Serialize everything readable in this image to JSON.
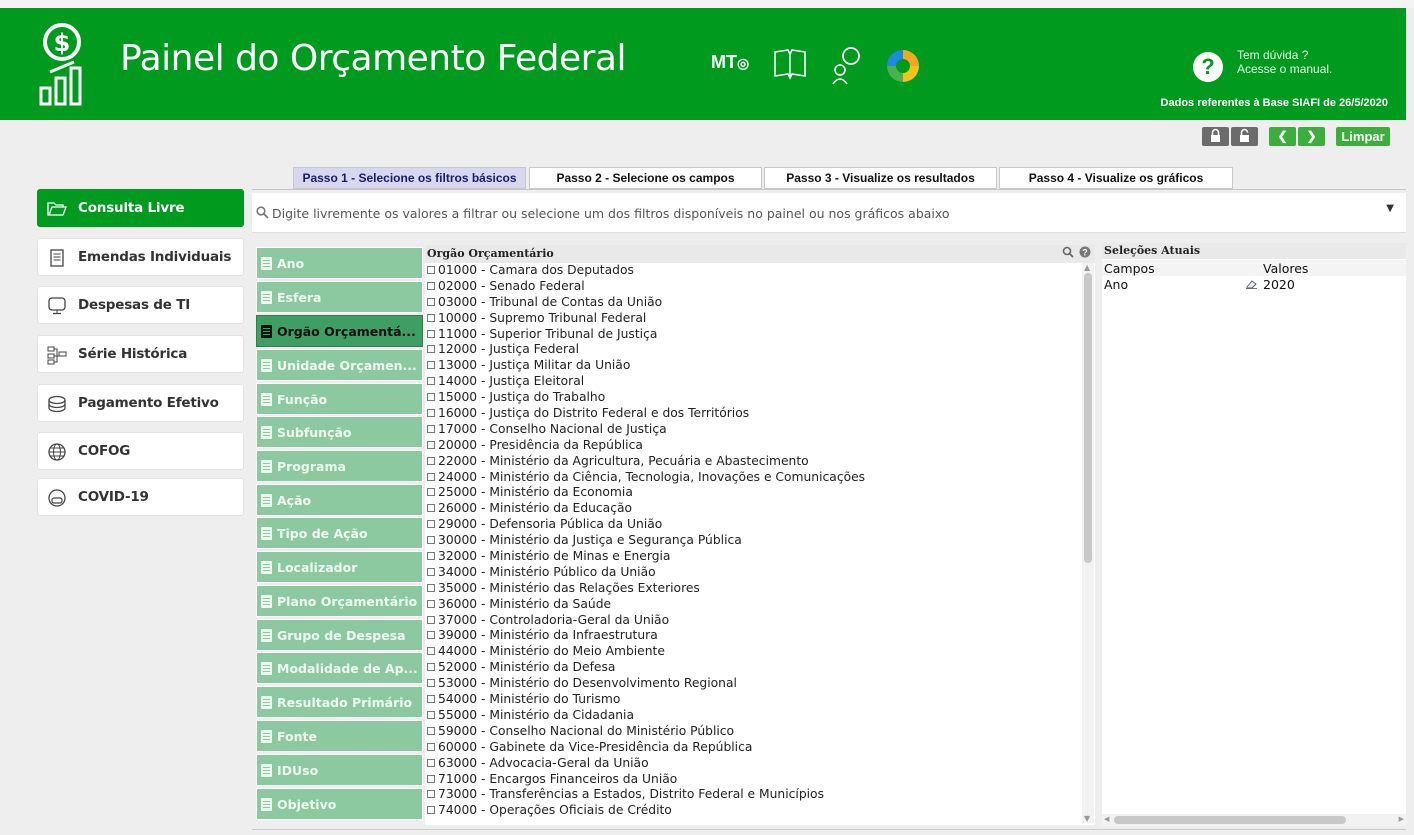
{
  "header": {
    "title": "Painel do Orçamento Federal",
    "mt_logo": "MT",
    "help_line1": "Tem dúvida ?",
    "help_line2": "Acesse o manual.",
    "base_date": "Dados referentes à Base SIAFI de 26/5/2020",
    "brand_color": "#009a1e"
  },
  "toolbar": {
    "limpar_label": "Limpar"
  },
  "tabs": [
    {
      "label": "Passo 1 - Selecione os filtros básicos",
      "active": true
    },
    {
      "label": "Passo 2 - Selecione os campos"
    },
    {
      "label": "Passo 3 - Visualize os resultados"
    },
    {
      "label": "Passo 4 - Visualize os gráficos"
    }
  ],
  "search": {
    "placeholder": "Digite livremente os valores a filtrar ou selecione um dos filtros disponíveis no painel ou nos gráficos abaixo"
  },
  "sidebar": {
    "items": [
      {
        "label": "Consulta Livre",
        "icon": "folder-open-icon",
        "active": true
      },
      {
        "label": "Emendas Individuais",
        "icon": "document-icon"
      },
      {
        "label": "Despesas de TI",
        "icon": "monitor-icon"
      },
      {
        "label": "Série Histórica",
        "icon": "hierarchy-icon"
      },
      {
        "label": "Pagamento Efetivo",
        "icon": "coins-icon"
      },
      {
        "label": "COFOG",
        "icon": "globe-icon"
      },
      {
        "label": "COVID-19",
        "icon": "mask-icon"
      }
    ]
  },
  "filters": [
    {
      "label": "Ano"
    },
    {
      "label": "Esfera"
    },
    {
      "label": "Orgão Orçamentá...",
      "active": true
    },
    {
      "label": "Unidade Orçamen..."
    },
    {
      "label": "Função"
    },
    {
      "label": "Subfunção"
    },
    {
      "label": "Programa"
    },
    {
      "label": "Ação"
    },
    {
      "label": "Tipo de Ação"
    },
    {
      "label": "Localizador"
    },
    {
      "label": "Plano Orçamentário"
    },
    {
      "label": "Grupo de Despesa"
    },
    {
      "label": "Modalidade de Ap..."
    },
    {
      "label": "Resultado Primário"
    },
    {
      "label": "Fonte"
    },
    {
      "label": "IDUso"
    },
    {
      "label": "Objetivo"
    }
  ],
  "list": {
    "title": "Orgão Orçamentário",
    "items": [
      "01000 - Camara dos Deputados",
      "02000 - Senado Federal",
      "03000 - Tribunal de Contas da União",
      "10000 - Supremo Tribunal Federal",
      "11000 - Superior Tribunal de Justiça",
      "12000 - Justiça Federal",
      "13000 - Justiça Militar da União",
      "14000 - Justiça Eleitoral",
      "15000 - Justiça do Trabalho",
      "16000 - Justiça do Distrito Federal e dos Territórios",
      "17000 - Conselho Nacional de Justiça",
      "20000 - Presidência da República",
      "22000 - Ministério da Agricultura, Pecuária e Abastecimento",
      "24000 - Ministério da Ciência, Tecnologia, Inovações e Comunicações",
      "25000 - Ministério da Economia",
      "26000 - Ministério da Educação",
      "29000 - Defensoria Pública da União",
      "30000 - Ministério da Justiça e Segurança Pública",
      "32000 - Ministério de Minas e Energia",
      "34000 - Ministério Público da União",
      "35000 - Ministério das Relações Exteriores",
      "36000 - Ministério da Saúde",
      "37000 - Controladoria-Geral da União",
      "39000 - Ministério da Infraestrutura",
      "44000 - Ministério do Meio Ambiente",
      "52000 - Ministério da Defesa",
      "53000 - Ministério do Desenvolvimento Regional",
      "54000 - Ministério do Turismo",
      "55000 - Ministério da Cidadania",
      "59000 - Conselho Nacional do Ministério Público",
      "60000 - Gabinete da Vice-Presidência da República",
      "63000 - Advocacia-Geral da União",
      "71000 - Encargos Financeiros da União",
      "73000 - Transferências a Estados, Distrito Federal e Municípios",
      "74000 - Operações Oficiais de Crédito"
    ]
  },
  "selections": {
    "title": "Seleções Atuais",
    "col_campos": "Campos",
    "col_valores": "Valores",
    "rows": [
      {
        "campo": "Ano",
        "valor": "2020"
      }
    ]
  }
}
